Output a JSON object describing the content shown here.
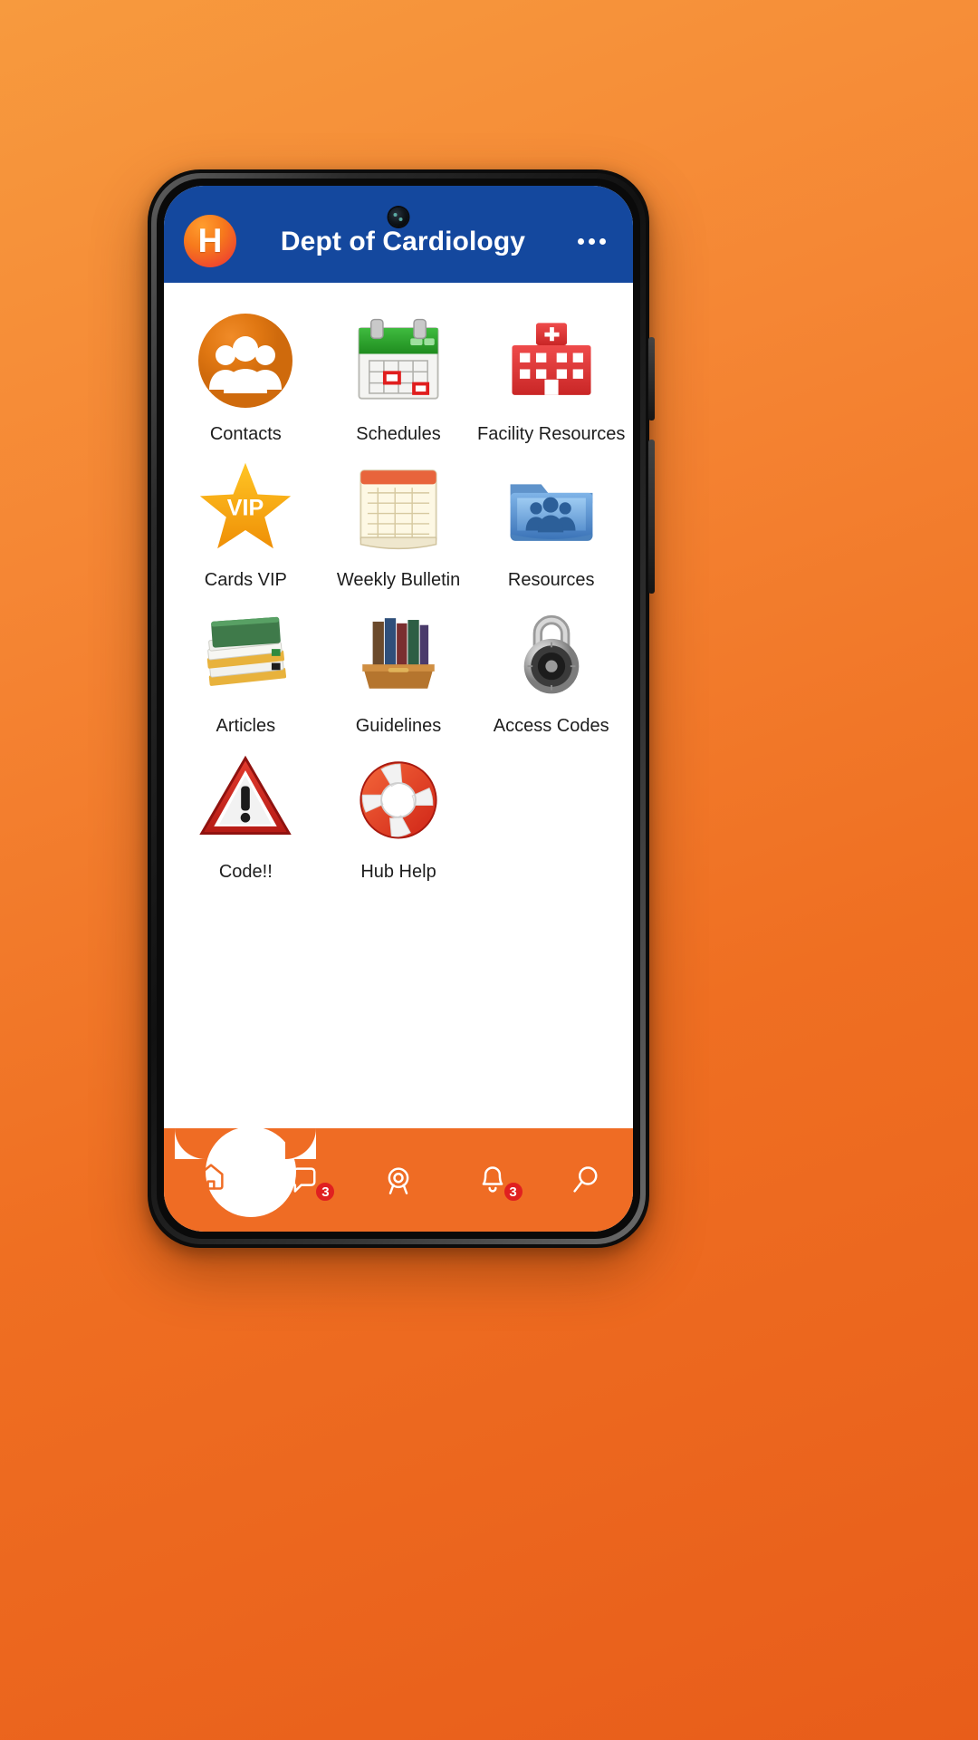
{
  "header": {
    "logo_letter": "H",
    "title": "Dept of Cardiology",
    "more_menu": "…",
    "bg_color": "#14489e",
    "title_color": "#ffffff"
  },
  "theme": {
    "background_gradient_start": "#f79a3e",
    "background_gradient_end": "#e85d1a",
    "accent_orange": "#ef6c24",
    "header_blue": "#14489e",
    "badge_red": "#e02020"
  },
  "grid": {
    "rows": [
      [
        {
          "label": "Contacts",
          "icon": "people-circle-icon"
        },
        {
          "label": "Schedules",
          "icon": "calendar-icon"
        },
        {
          "label": "Facility Resources",
          "icon": "hospital-icon"
        }
      ],
      [
        {
          "label": "Cards VIP",
          "icon": "vip-star-icon"
        },
        {
          "label": "Weekly Bulletin",
          "icon": "bulletin-pad-icon"
        },
        {
          "label": "Resources",
          "icon": "folder-people-icon"
        }
      ],
      [
        {
          "label": "Articles",
          "icon": "stacked-papers-icon"
        },
        {
          "label": "Guidelines",
          "icon": "book-box-icon"
        },
        {
          "label": "Access Codes",
          "icon": "padlock-icon"
        }
      ],
      [
        {
          "label": "Code!!",
          "icon": "warning-triangle-icon"
        },
        {
          "label": "Hub Help",
          "icon": "lifebuoy-icon"
        }
      ]
    ]
  },
  "bottom_nav": {
    "items": [
      {
        "name": "home",
        "icon": "home-icon",
        "badge": null,
        "active": true
      },
      {
        "name": "messages",
        "icon": "chat-bubble-icon",
        "badge": "3",
        "active": false
      },
      {
        "name": "discover",
        "icon": "target-icon",
        "badge": null,
        "active": false
      },
      {
        "name": "notifications",
        "icon": "bell-icon",
        "badge": "3",
        "active": false
      },
      {
        "name": "search",
        "icon": "search-icon",
        "badge": null,
        "active": false
      }
    ]
  }
}
